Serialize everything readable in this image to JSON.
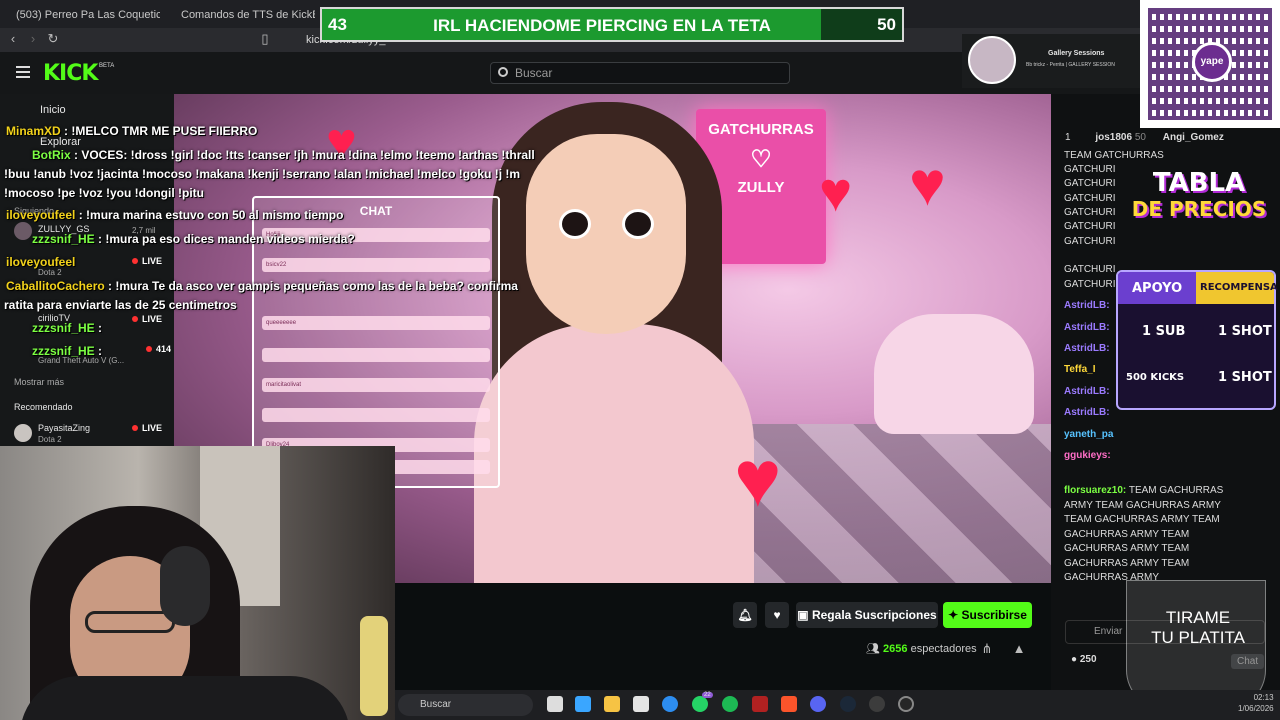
{
  "browser": {
    "tabs": [
      {
        "label": "(503) Perreo Pa Las Coqueticas Mix - D"
      },
      {
        "label": "Comandos de TTS de KickBot"
      }
    ],
    "url": "kick.com/zullyy_"
  },
  "header": {
    "logo": "KICK",
    "logo_badge": "BETA",
    "search_placeholder": "Buscar"
  },
  "banner": {
    "left_value": "43",
    "title": "IRL HACIENDOME PIERCING EN LA TETA",
    "right_value": "50",
    "progress": 0.86
  },
  "sidebar": {
    "inicio": "Inicio",
    "explorar": "Explorar",
    "siguiendo": "Siguiendo",
    "following": [
      {
        "name": "ZULLYY_GS",
        "count": "2,7 mil"
      },
      {
        "name": "iloveyoufeel",
        "sub": "Dota 2",
        "live": "LIVE"
      },
      {
        "name": "cirilioTV",
        "live": "LIVE"
      },
      {
        "name": "Grand Theft Auto V (G...",
        "count": "414"
      }
    ],
    "mostrar_mas": "Mostrar más",
    "recomendado": "Recomendado",
    "recommended": [
      {
        "name": "PayasitaZing",
        "sub": "Dota 2",
        "live": "LIVE"
      }
    ]
  },
  "tts_chat": [
    {
      "user": "MinamXD",
      "text": " : !MELCO TMR ME PUSE FIIERRO",
      "color": "u-y"
    },
    {
      "user": "BotRix",
      "text": " : VOCES: !dross !girl !doc !tts !canser !jh !mura !dina !elmo !teemo !arthas !thrall",
      "color": "u-g"
    },
    {
      "user": "",
      "text": "!buu !anub !voz !jacinta !mocoso !makana !kenji !serrano !alan !michael !melco !goku !j !m",
      "color": ""
    },
    {
      "user": "",
      "text": "!mocoso !pe !voz !you !dongil !pitu",
      "color": ""
    },
    {
      "user": "iloveyoufeel",
      "text": " : !mura marina estuvo con 50 al mismo tiempo",
      "color": "u-y"
    },
    {
      "user": "zzzsnif_HE",
      "text": " : !mura pa eso dices manden videos mierda?",
      "color": "u-g"
    },
    {
      "user": "iloveyoufeel",
      "text": "",
      "color": "u-y"
    },
    {
      "user": "CaballitoCachero",
      "text": " : !mura Te da asco ver gampis pequeñas como las de la beba? confirma",
      "color": "u-y"
    },
    {
      "user": "",
      "text": "ratita para enviarte las de 25 centimetros",
      "color": ""
    },
    {
      "user": "zzzsnif_HE",
      "text": " :",
      "color": "u-g"
    },
    {
      "user": "zzzsnif_HE",
      "text": " :",
      "color": "u-g"
    }
  ],
  "stream_overlay": {
    "chat_title": "CHAT",
    "neon_line1": "GATCHURRAS",
    "neon_line2": "♡",
    "neon_line3": "ZULLY",
    "chat_rows": [
      "Holiiii",
      "bsicv22",
      "queeeeeee",
      "",
      "maricitaolivat",
      "",
      "",
      "Dliboy24",
      "KA REVIVIO"
    ]
  },
  "actions": {
    "bell_icon": "bell-icon",
    "heart_icon": "heart-icon",
    "gift_label": "Regala Suscripciones",
    "subscribe_label": "Suscribirse",
    "viewers_count": "2656",
    "viewers_label": "espectadores"
  },
  "gallery": {
    "title": "Gallery Sessions",
    "subtitle": "Bb trickz - Perrita | GALLERY SESSION"
  },
  "qr": {
    "label": "yape"
  },
  "chat": {
    "leader_rank": "1",
    "leader_name": "jos1806",
    "leader_amount": "50",
    "leader_second": "Angi_Gomez",
    "lines": [
      {
        "user": "",
        "text": "TEAM GATCHURRAS",
        "color": "#fff"
      },
      {
        "user": "",
        "text": "GATCHURI",
        "color": "#fff"
      },
      {
        "user": "",
        "text": "GATCHURI",
        "color": "#fff"
      },
      {
        "user": "",
        "text": "GATCHURI",
        "color": "#fff"
      },
      {
        "user": "",
        "text": "GATCHURI",
        "color": "#fff"
      },
      {
        "user": "",
        "text": "GATCHURI",
        "color": "#fff"
      },
      {
        "user": "",
        "text": "GATCHURI",
        "color": "#fff"
      },
      {
        "user": "",
        "text": "GATCHURI",
        "color": "#fff"
      },
      {
        "user": "",
        "text": "GATCHURI",
        "color": "#fff"
      },
      {
        "user": "AstridLB:",
        "text": "",
        "color": "#9b7bff"
      },
      {
        "user": "AstridLB:",
        "text": "",
        "color": "#9b7bff"
      },
      {
        "user": "AstridLB:",
        "text": "",
        "color": "#9b7bff"
      },
      {
        "user": "Teffa_I",
        "text": "",
        "color": "#ffd93a"
      },
      {
        "user": "AstridLB:",
        "text": "",
        "color": "#9b7bff"
      },
      {
        "user": "AstridLB:",
        "text": "",
        "color": "#9b7bff"
      },
      {
        "user": "yaneth_pa",
        "text": "",
        "color": "#57c3ff"
      },
      {
        "user": "ggukieys:",
        "text": "",
        "color": "#ff6ec7"
      }
    ],
    "florsuarez_user": "florsuarez10:",
    "florsuarez_text": "TEAM GACHURRAS",
    "army_lines": [
      "ARMY   TEAM GACHURRAS ARMY",
      "TEAM GACHURRAS ARMY   TEAM",
      "GACHURRAS ARMY   TEAM",
      "GACHURRAS ARMY   TEAM",
      "GACHURRAS ARMY   TEAM",
      "GACHURRAS ARMY"
    ],
    "send_placeholder": "Enviar",
    "kicks_count": "250",
    "chat_button": "Chat"
  },
  "precios": {
    "title1": "TABLA",
    "title2": "DE PRECIOS",
    "col1": "APOYO",
    "col2": "RECOMPENSA",
    "row1_left": "1 SUB",
    "row1_right": "1 SHOT",
    "row2_left": "500 KICKS",
    "row2_right": "1 SHOT"
  },
  "tirame": {
    "line1": "TIRAME",
    "line2": "TU PLATITA"
  },
  "taskbar": {
    "search": "Buscar",
    "badge_whatsapp": "22",
    "time": "02:13",
    "date": "1/06/2026"
  }
}
